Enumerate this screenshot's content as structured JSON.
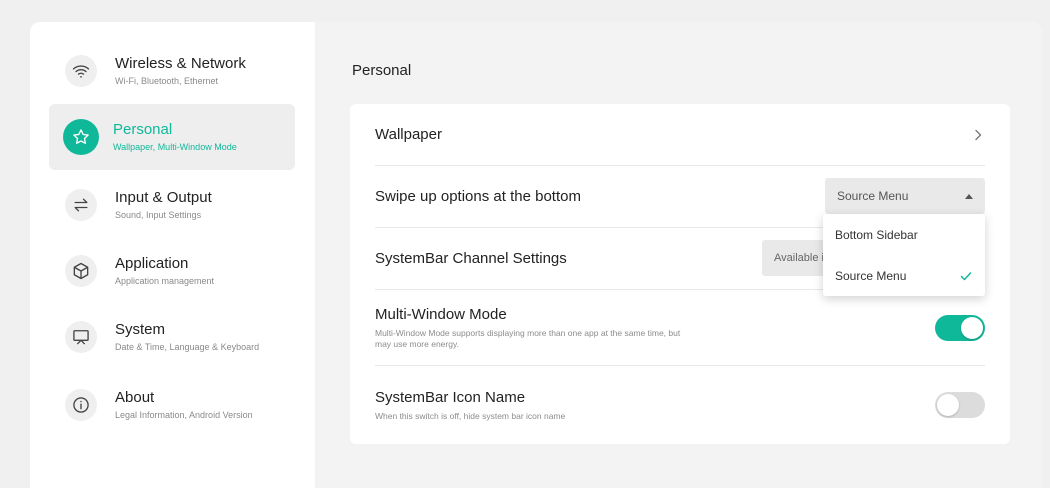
{
  "sidebar": {
    "items": [
      {
        "title": "Wireless & Network",
        "subtitle": "Wi-Fi, Bluetooth, Ethernet",
        "icon": "wifi-icon"
      },
      {
        "title": "Personal",
        "subtitle": "Wallpaper, Multi-Window Mode",
        "icon": "star-icon"
      },
      {
        "title": "Input & Output",
        "subtitle": "Sound, Input Settings",
        "icon": "swap-arrows-icon"
      },
      {
        "title": "Application",
        "subtitle": "Application management",
        "icon": "cube-icon"
      },
      {
        "title": "System",
        "subtitle": "Date & Time, Language & Keyboard",
        "icon": "monitor-icon"
      },
      {
        "title": "About",
        "subtitle": "Legal Information, Android Version",
        "icon": "info-icon"
      }
    ]
  },
  "main": {
    "section_title": "Personal",
    "rows": {
      "wallpaper": {
        "title": "Wallpaper"
      },
      "swipe": {
        "title": "Swipe up options at the bottom",
        "selected": "Source Menu"
      },
      "channel": {
        "title": "SystemBar Channel Settings",
        "value": "Available in a"
      },
      "multiwindow": {
        "title": "Multi-Window Mode",
        "description": "Multi-Window Mode supports displaying more than one app at the same time, but may use more energy.",
        "enabled": true
      },
      "iconname": {
        "title": "SystemBar Icon Name",
        "description": "When this switch is off, hide system bar icon name",
        "enabled": false
      }
    },
    "popup": {
      "options": [
        {
          "label": "Bottom Sidebar",
          "checked": false
        },
        {
          "label": "Source Menu",
          "checked": true
        }
      ]
    }
  },
  "colors": {
    "accent": "#10b89a",
    "background": "#f3f3f3"
  }
}
